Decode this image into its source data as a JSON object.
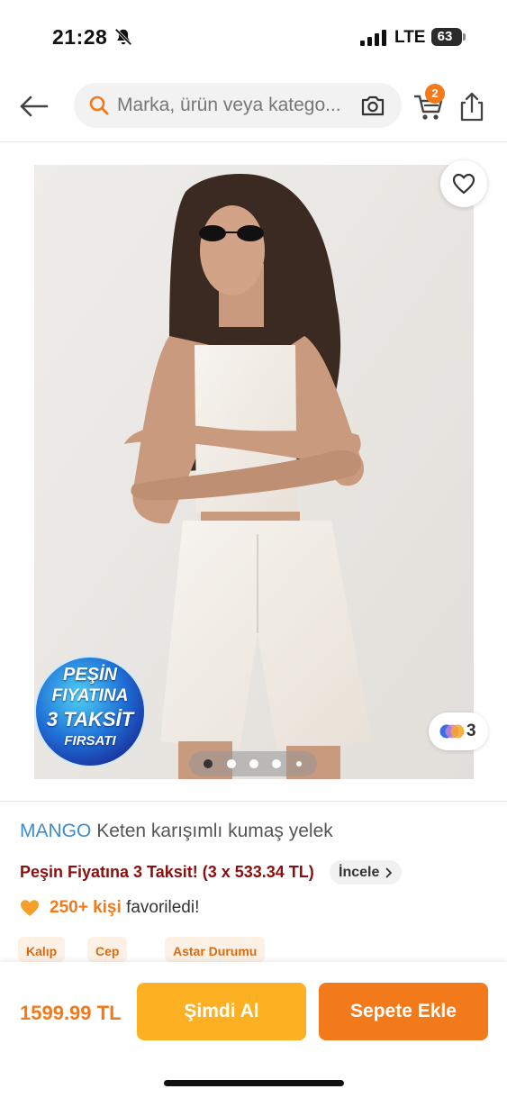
{
  "status_bar": {
    "time": "21:28",
    "network": "LTE",
    "battery": "63"
  },
  "header": {
    "search_placeholder": "Marka, ürün veya katego...",
    "cart_count": "2"
  },
  "gallery": {
    "promo_badge": {
      "line1": "PEŞİN",
      "line2": "FIYATINA",
      "line3": "3 TAKSİT",
      "line4": "FIRSATI"
    },
    "variant_count": "3",
    "page_dots": 5,
    "active_dot": 1
  },
  "product": {
    "brand": "MANGO",
    "name": "Keten karışımlı kumaş yelek",
    "installment_text": "Peşin Fiyatına 3 Taksit! (3 x 533.34 TL)",
    "installment_link": "İncele",
    "favorite_count": "250+ kişi",
    "favorite_suffix": "favoriledi!",
    "chips": [
      "Kalıp",
      "Cep",
      "Astar Durumu"
    ]
  },
  "bottom_bar": {
    "price": "1599.99 TL",
    "buy_now_label": "Şimdi Al",
    "add_to_cart_label": "Sepete Ekle"
  },
  "colors": {
    "accent": "#f27a1a",
    "buy_now": "#fdb022",
    "brand_link": "#3f8bc9",
    "installment": "#8a0f0f"
  }
}
